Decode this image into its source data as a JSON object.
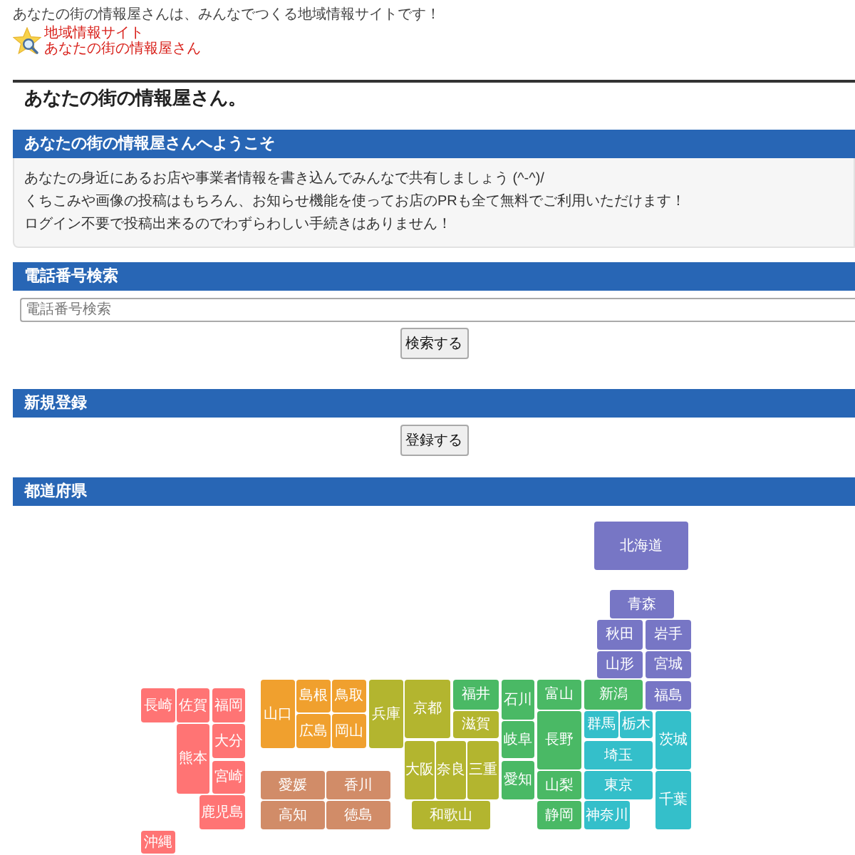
{
  "header": {
    "tagline": "あなたの街の情報屋さんは、みんなでつくる地域情報サイトです！",
    "logo_lines": [
      "地域情報サイト",
      "あなたの街の情報屋さん"
    ]
  },
  "page_title": "あなたの街の情報屋さん。",
  "welcome": {
    "heading": "あなたの街の情報屋さんへようこそ",
    "lines": [
      "あなたの身近にあるお店や事業者情報を書き込んでみんなで共有しましょう (^-^)/",
      "くちこみや画像の投稿はもちろん、お知らせ機能を使ってお店のPRも全て無料でご利用いただけます！",
      "ログイン不要で投稿出来るのでわずらわしい手続きはありません！"
    ]
  },
  "phone_search": {
    "heading": "電話番号検索",
    "placeholder": "電話番号検索",
    "button": "検索する"
  },
  "registration": {
    "heading": "新規登録",
    "button": "登録する"
  },
  "prefecture_map": {
    "heading": "都道府県",
    "regions": [
      {
        "color": "#7776c5",
        "prefectures": [
          "北海道",
          "青森",
          "秋田",
          "岩手",
          "山形",
          "宮城",
          "福島"
        ]
      },
      {
        "color": "#34bfca",
        "prefectures": [
          "群馬",
          "栃木",
          "茨城",
          "埼玉",
          "東京",
          "千葉",
          "神奈川"
        ]
      },
      {
        "color": "#4ab965",
        "prefectures": [
          "福井",
          "石川",
          "富山",
          "新潟",
          "長野",
          "岐阜",
          "愛知",
          "山梨",
          "静岡"
        ]
      },
      {
        "color": "#b3b52f",
        "prefectures": [
          "兵庫",
          "京都",
          "滋賀",
          "大阪",
          "奈良",
          "三重",
          "和歌山"
        ]
      },
      {
        "color": "#f0a02e",
        "prefectures": [
          "山口",
          "島根",
          "鳥取",
          "広島",
          "岡山"
        ]
      },
      {
        "color": "#d18c68",
        "prefectures": [
          "愛媛",
          "香川",
          "高知",
          "徳島"
        ]
      },
      {
        "color": "#ff7474",
        "prefectures": [
          "長崎",
          "佐賀",
          "福岡",
          "熊本",
          "大分",
          "宮崎",
          "鹿児島",
          "沖縄"
        ]
      }
    ]
  }
}
